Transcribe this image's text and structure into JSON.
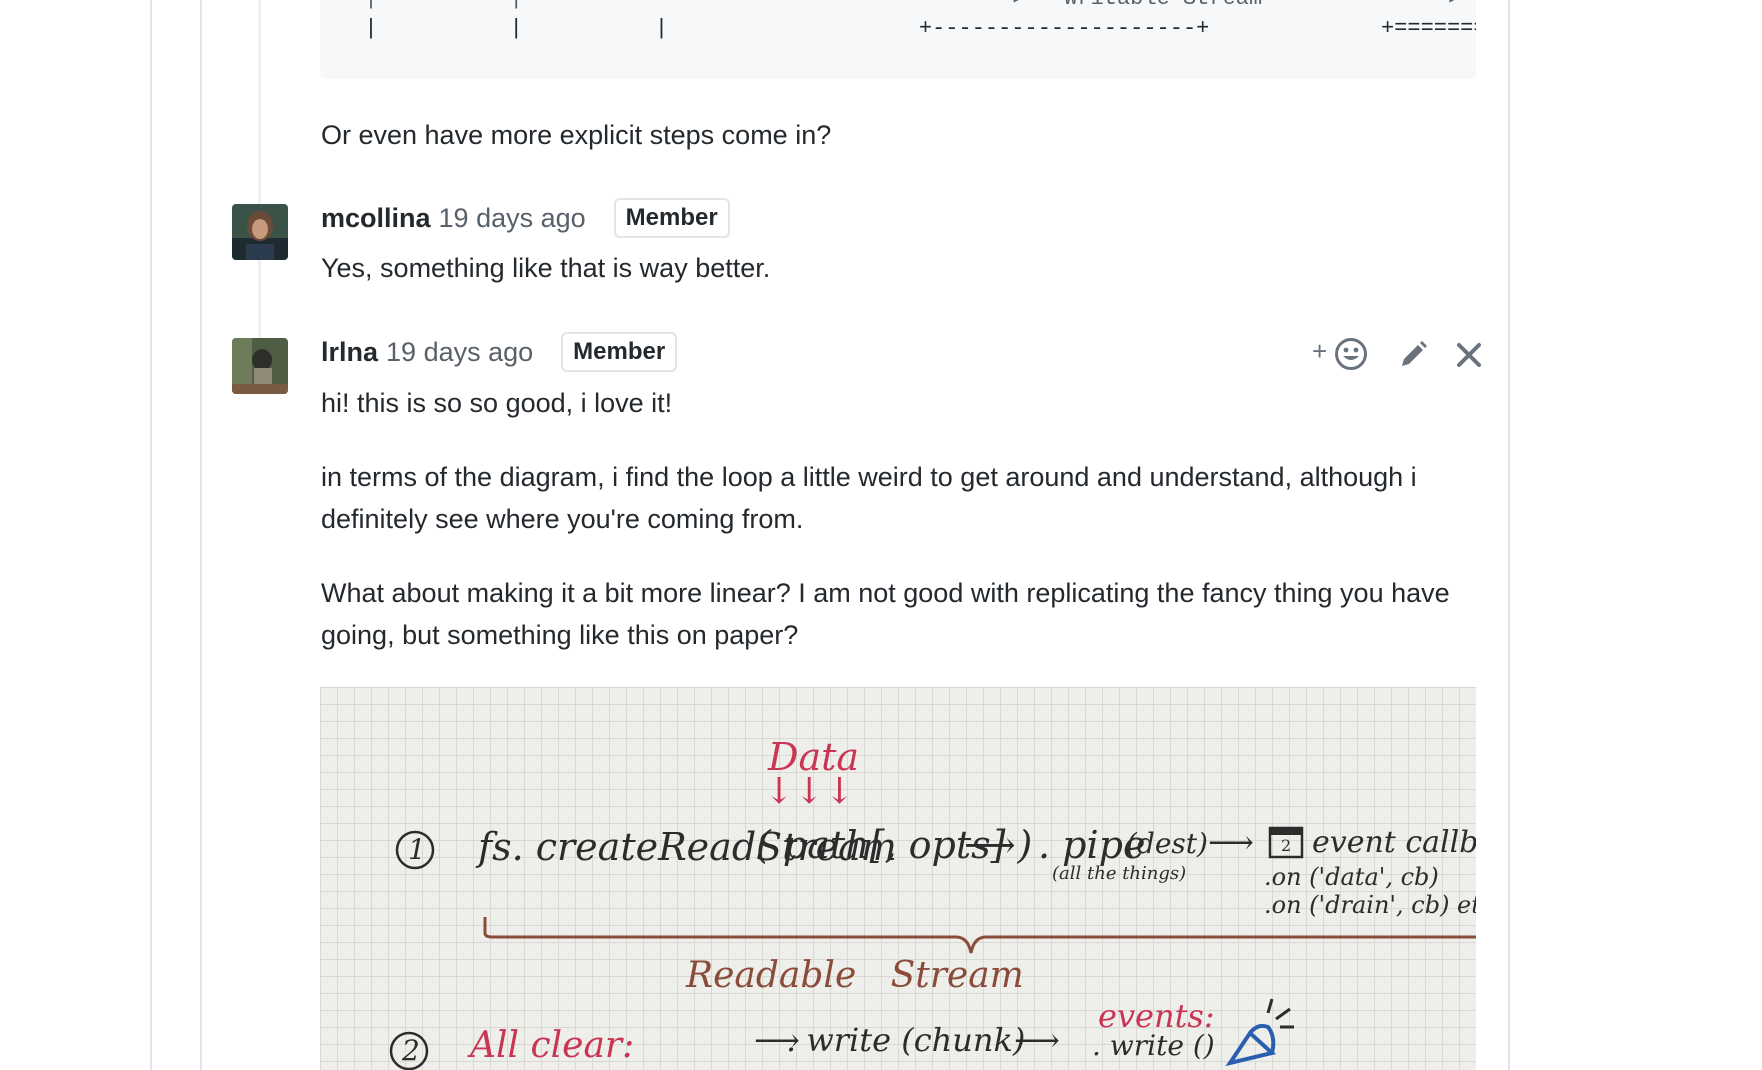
{
  "code": {
    "line1": "  |          |          ·  ·  ·  ·  ·  ·  ·  ·     ▸   Writable Stream   ·          ▸   .write(chunk)",
    "line2": "  |          |          |                   +--------------------+             +=======+========="
  },
  "thread": {
    "question": "Or even have more explicit steps come in?",
    "comments": [
      {
        "author": "mcollina",
        "time": "19 days ago",
        "badge": "Member",
        "body": [
          "Yes, something like that is way better."
        ]
      },
      {
        "author": "lrlna",
        "time": "19 days ago",
        "badge": "Member",
        "body": [
          "hi! this is so so good, i love it!",
          "in terms of the diagram, i find the loop a little weird to get around and understand, although i definitely see where you're coming from.",
          "What about making it a bit more linear? I am not good with replicating the fancy thing you have going, but something like this on paper?"
        ]
      }
    ]
  },
  "actions": {
    "plus": "+"
  },
  "sketch": {
    "data": "Data",
    "arrows": "↓↓↓",
    "step1_num": "1",
    "step1_call": "fs. createReadStream",
    "step1_args": "( path[, opts] )",
    "arrow1": "⟶",
    "pipe": ". pipe",
    "pipe_dest": "(dest)",
    "pipe_note": "(all the things)",
    "arrow2": "⟶",
    "callbacks": "event callbacks",
    "cal_num": "2",
    "on_data": ".on ('data', cb)",
    "on_drain": ".on ('drain', cb)  etc",
    "readable_label": "Readable   Stream",
    "step2_num": "2",
    "all_clear": "All clear:",
    "write_arrow": "⟶",
    "write": ". write (chunk)",
    "arrow3": "⟶",
    "events": "events:",
    "events_write": ". write ()"
  },
  "colors": {
    "text": "#24292e",
    "muted": "#586069",
    "border": "#e1e4e8",
    "code_bg": "#f6f8fa",
    "sketch_red": "#c93552",
    "sketch_brown": "#8a4b3a",
    "sketch_blue": "#2a5fb0"
  }
}
